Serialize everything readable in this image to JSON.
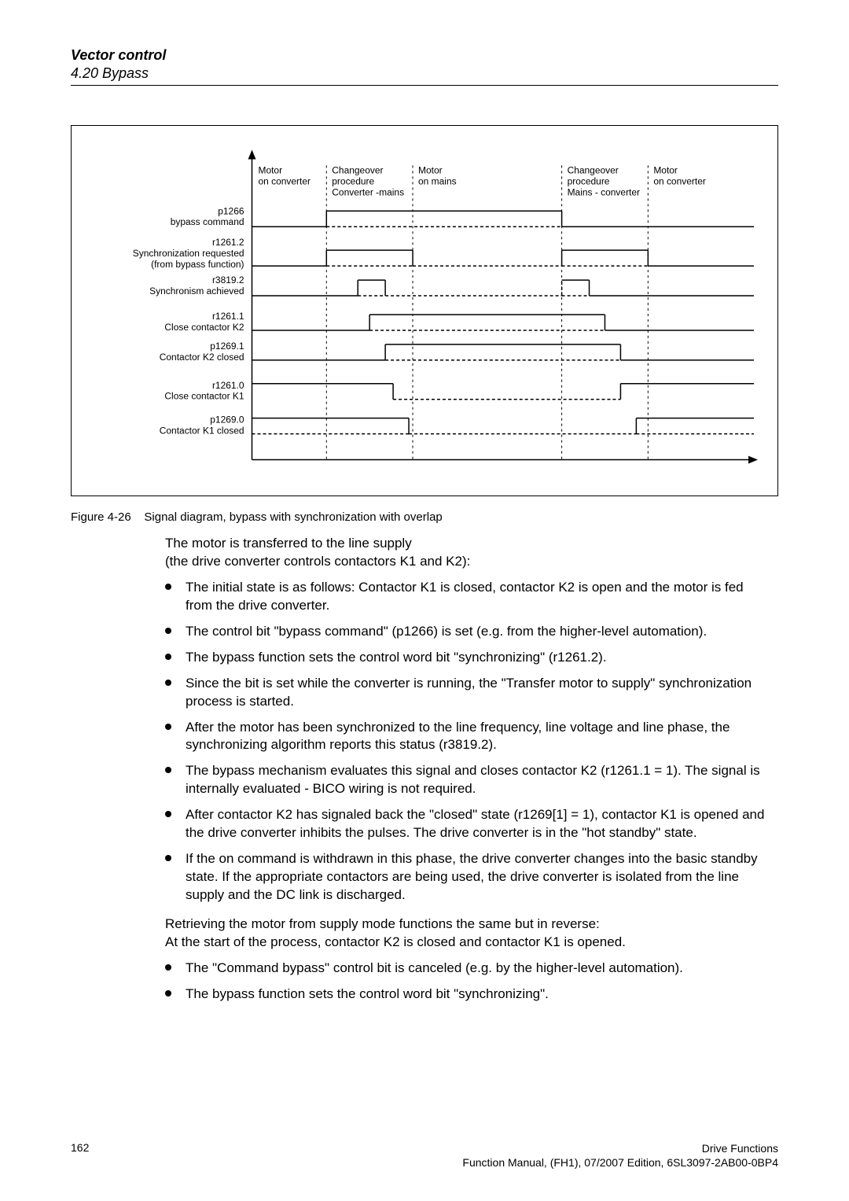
{
  "header": {
    "title": "Vector control",
    "section": "4.20 Bypass"
  },
  "figure": {
    "caption_prefix": "Figure 4-26",
    "caption_text": "Signal diagram, bypass with synchronization with overlap",
    "phases": {
      "a": {
        "line1": "Motor",
        "line2": "on converter"
      },
      "b": {
        "line1": "Changeover",
        "line2": "procedure",
        "line3": "Converter -mains"
      },
      "c": {
        "line1": "Motor",
        "line2": "on mains"
      },
      "d": {
        "line1": "Changeover",
        "line2": "procedure",
        "line3": "Mains - converter"
      },
      "e": {
        "line1": "Motor",
        "line2": "on converter"
      }
    },
    "rows": [
      {
        "code": "p1266",
        "label": "bypass command"
      },
      {
        "code": "r1261.2",
        "label1": "Synchronization requested",
        "label2": "(from bypass function)"
      },
      {
        "code": "r3819.2",
        "label": "Synchronism achieved"
      },
      {
        "code": "r1261.1",
        "label": "Close contactor K2"
      },
      {
        "code": "p1269.1",
        "label": "Contactor K2 closed"
      },
      {
        "code": "r1261.0",
        "label": "Close contactor K1"
      },
      {
        "code": "p1269.0",
        "label": "Contactor K1 closed"
      }
    ]
  },
  "body": {
    "intro1": "The motor is transferred to the line supply",
    "intro2": "(the drive converter controls contactors K1 and K2):",
    "bullets1": [
      "The initial state is as follows: Contactor K1 is closed, contactor K2 is open and the motor is fed from the drive converter.",
      "The control bit \"bypass command\" (p1266) is set (e.g. from the higher-level automation).",
      "The bypass function sets the control word bit \"synchronizing\" (r1261.2).",
      "Since the bit is set while the converter is running, the \"Transfer motor to supply\" synchronization process is started.",
      "After the motor has been synchronized to the line frequency, line voltage and line phase, the synchronizing algorithm reports this status (r3819.2).",
      "The bypass mechanism evaluates this signal and closes contactor K2 (r1261.1 = 1). The signal is internally evaluated - BICO wiring is not required.",
      "After contactor K2 has signaled back the \"closed\" state (r1269[1] = 1), contactor K1 is opened and the drive converter inhibits the pulses. The drive converter is in the \"hot standby\" state.",
      "If the on command is withdrawn in this phase, the drive converter changes into the basic standby state. If the appropriate contactors are being used, the drive converter is isolated from the line supply and the DC link is discharged."
    ],
    "retrieve1": "Retrieving the motor from supply mode functions the same but in reverse:",
    "retrieve2": "At the start of the process, contactor K2 is closed and contactor K1 is opened.",
    "bullets2": [
      "The \"Command bypass\" control bit is canceled (e.g. by the higher-level automation).",
      "The bypass function sets the control word bit \"synchronizing\"."
    ]
  },
  "footer": {
    "page": "162",
    "right1": "Drive Functions",
    "right2": "Function Manual, (FH1), 07/2007 Edition, 6SL3097-2AB00-0BP4"
  }
}
